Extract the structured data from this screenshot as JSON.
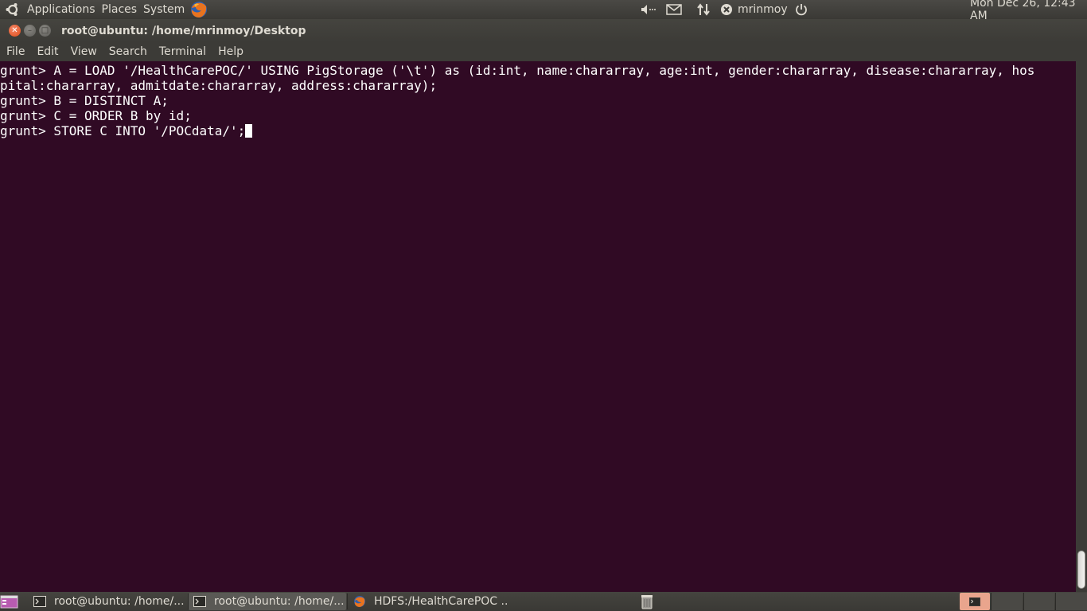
{
  "top_panel": {
    "menus": [
      "Applications",
      "Places",
      "System"
    ],
    "user": "mrinmoy",
    "clock": "Mon Dec 26, 12:43 AM"
  },
  "window": {
    "title": "root@ubuntu: /home/mrinmoy/Desktop"
  },
  "menubar": {
    "items": [
      "File",
      "Edit",
      "View",
      "Search",
      "Terminal",
      "Help"
    ]
  },
  "terminal": {
    "lines": [
      "grunt> A = LOAD '/HealthCarePOC/' USING PigStorage ('\\t') as (id:int, name:chararray, age:int, gender:chararray, disease:chararray, hos",
      "pital:chararray, admitdate:chararray, address:chararray);",
      "grunt> B = DISTINCT A;",
      "grunt> C = ORDER B by id;",
      "grunt> STORE C INTO '/POCdata/';"
    ]
  },
  "taskbar": {
    "tasks": [
      {
        "label": "root@ubuntu: /home/...",
        "icon": "terminal-icon"
      },
      {
        "label": "root@ubuntu: /home/...",
        "icon": "terminal-icon"
      },
      {
        "label": "HDFS:/HealthCarePOC ...",
        "icon": "firefox-icon"
      }
    ]
  },
  "colors": {
    "terminal_bg": "#300a24",
    "panel_bg": "#3c3b37",
    "close_button": "#df4a16"
  }
}
